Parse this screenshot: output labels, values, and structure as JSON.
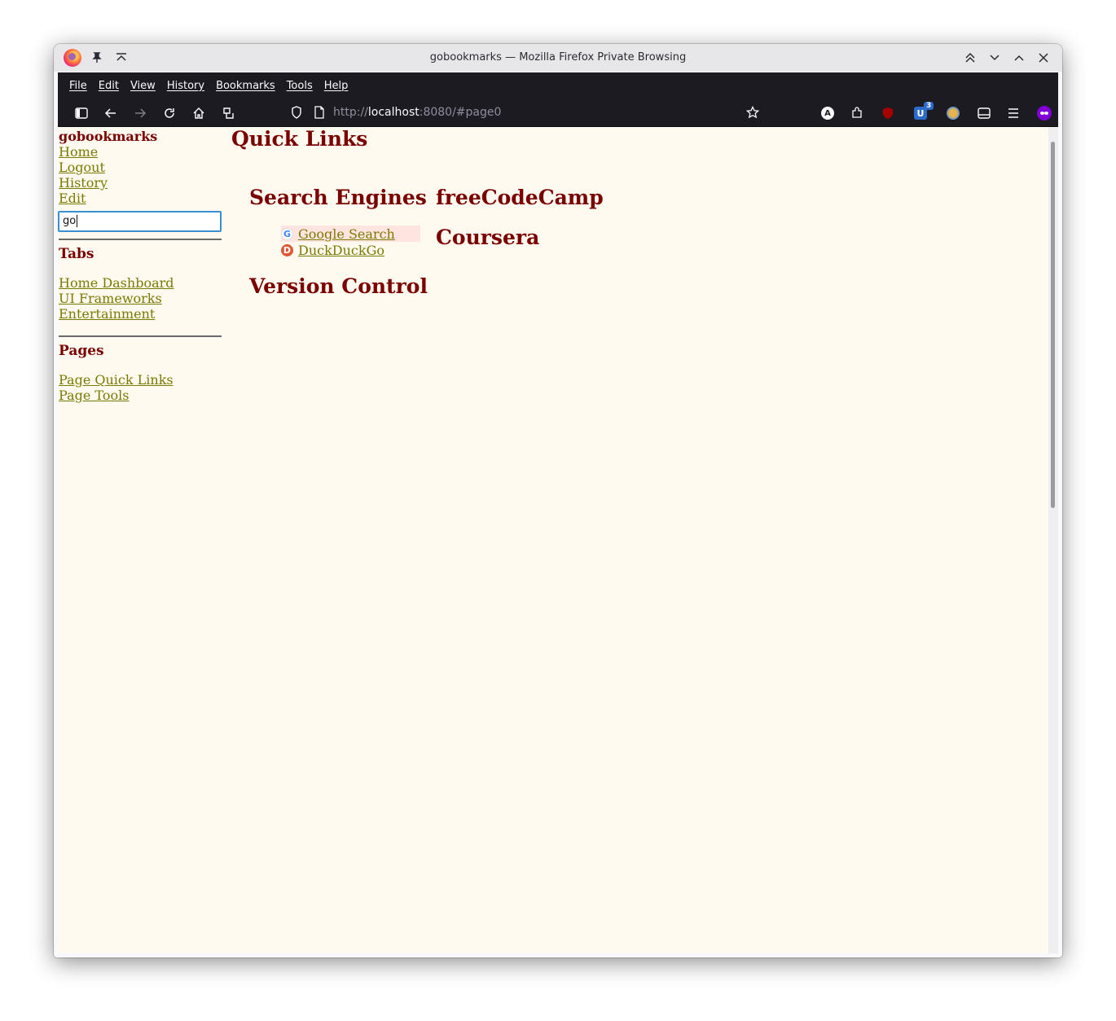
{
  "window": {
    "title": "gobookmarks — Mozilla Firefox Private Browsing"
  },
  "menubar": {
    "items": [
      "File",
      "Edit",
      "View",
      "History",
      "Bookmarks",
      "Tools",
      "Help"
    ]
  },
  "toolbar": {
    "url_scheme": "http://",
    "url_host": "localhost",
    "url_rest": ":8080/#page0",
    "extension_badge": "3"
  },
  "sidebar": {
    "brand": "gobookmarks",
    "nav": [
      "Home",
      "Logout",
      "History",
      "Edit"
    ],
    "search_value": "go",
    "tabs_heading": "Tabs",
    "tabs": [
      "Home Dashboard",
      "UI Frameworks",
      "Entertainment"
    ],
    "pages_heading": "Pages",
    "pages": [
      "Page Quick Links",
      "Page Tools"
    ]
  },
  "main": {
    "title": "Quick Links",
    "categories": [
      {
        "title": "Search Engines",
        "bookmarks": [
          {
            "label": "Google Search",
            "icon": "google-icon"
          },
          {
            "label": "DuckDuckGo",
            "icon": "duckduckgo-icon"
          }
        ]
      },
      {
        "title": "Version Control"
      },
      {
        "title": "freeCodeCamp"
      },
      {
        "title": "Coursera"
      }
    ]
  },
  "colors": {
    "heading": "#7a0000",
    "link": "#7a7a00",
    "page_bg": "#fffaef",
    "highlight_bg": "#ffe4e0"
  }
}
